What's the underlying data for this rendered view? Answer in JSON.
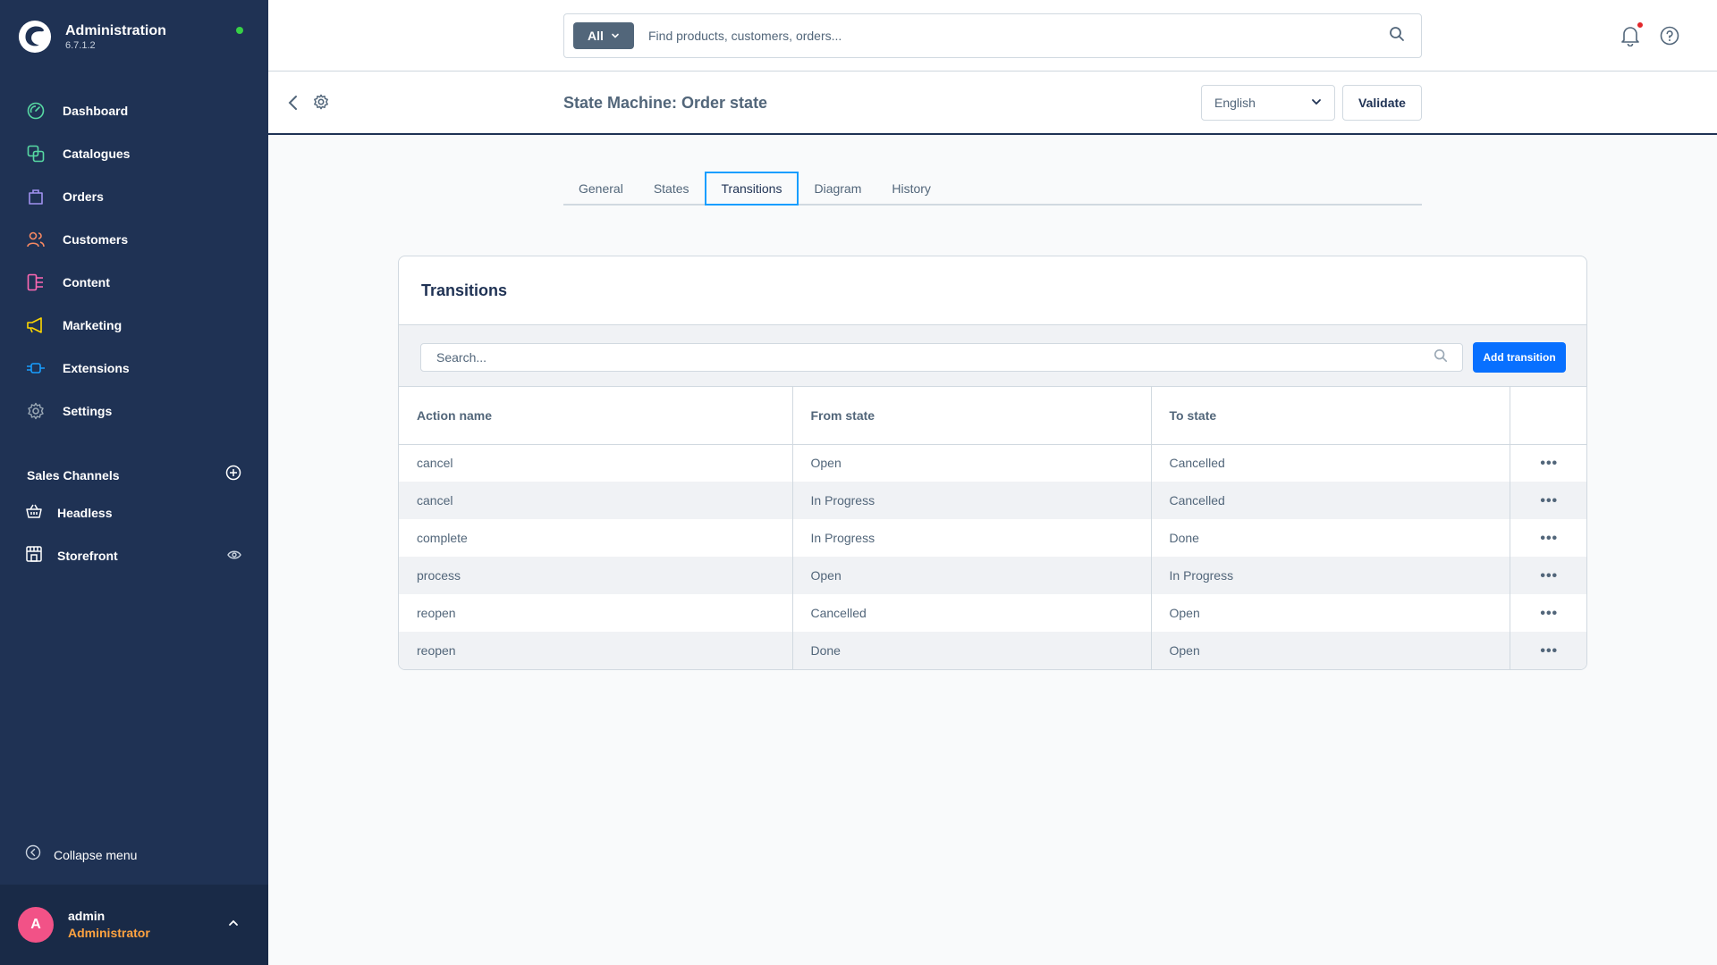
{
  "brand": {
    "title": "Administration",
    "version": "6.7.1.2"
  },
  "sidebar": {
    "items": [
      {
        "label": "Dashboard",
        "icon": "dashboard-icon",
        "color": "#57d9a3"
      },
      {
        "label": "Catalogues",
        "icon": "catalogue-icon",
        "color": "#57d9a3"
      },
      {
        "label": "Orders",
        "icon": "orders-icon",
        "color": "#a092f0"
      },
      {
        "label": "Customers",
        "icon": "customers-icon",
        "color": "#f88962"
      },
      {
        "label": "Content",
        "icon": "content-icon",
        "color": "#ff68b4"
      },
      {
        "label": "Marketing",
        "icon": "marketing-icon",
        "color": "#ffd700"
      },
      {
        "label": "Extensions",
        "icon": "extensions-icon",
        "color": "#189eff"
      },
      {
        "label": "Settings",
        "icon": "settings-icon",
        "color": "#9aa8b5"
      }
    ],
    "sales_channels_title": "Sales Channels",
    "sales_channels": [
      {
        "label": "Headless",
        "icon": "basket-icon"
      },
      {
        "label": "Storefront",
        "icon": "storefront-icon"
      }
    ],
    "collapse_label": "Collapse menu"
  },
  "user": {
    "initial": "A",
    "name": "admin",
    "role": "Administrator"
  },
  "search": {
    "type_label": "All",
    "placeholder": "Find products, customers, orders..."
  },
  "page": {
    "title": "State Machine: Order state",
    "language": "English",
    "validate_label": "Validate"
  },
  "tabs": [
    "General",
    "States",
    "Transitions",
    "Diagram",
    "History"
  ],
  "active_tab": "Transitions",
  "card": {
    "title": "Transitions",
    "search_placeholder": "Search...",
    "add_label": "Add transition",
    "columns": [
      "Action name",
      "From state",
      "To state"
    ],
    "rows": [
      {
        "action": "cancel",
        "from": "Open",
        "to": "Cancelled"
      },
      {
        "action": "cancel",
        "from": "In Progress",
        "to": "Cancelled"
      },
      {
        "action": "complete",
        "from": "In Progress",
        "to": "Done"
      },
      {
        "action": "process",
        "from": "Open",
        "to": "In Progress"
      },
      {
        "action": "reopen",
        "from": "Cancelled",
        "to": "Open"
      },
      {
        "action": "reopen",
        "from": "Done",
        "to": "Open"
      }
    ]
  },
  "colors": {
    "sidebar": "#1f3254",
    "accent": "#189eff",
    "primary_button": "#0870ff",
    "role": "#ffa340",
    "avatar": "#f25287"
  }
}
